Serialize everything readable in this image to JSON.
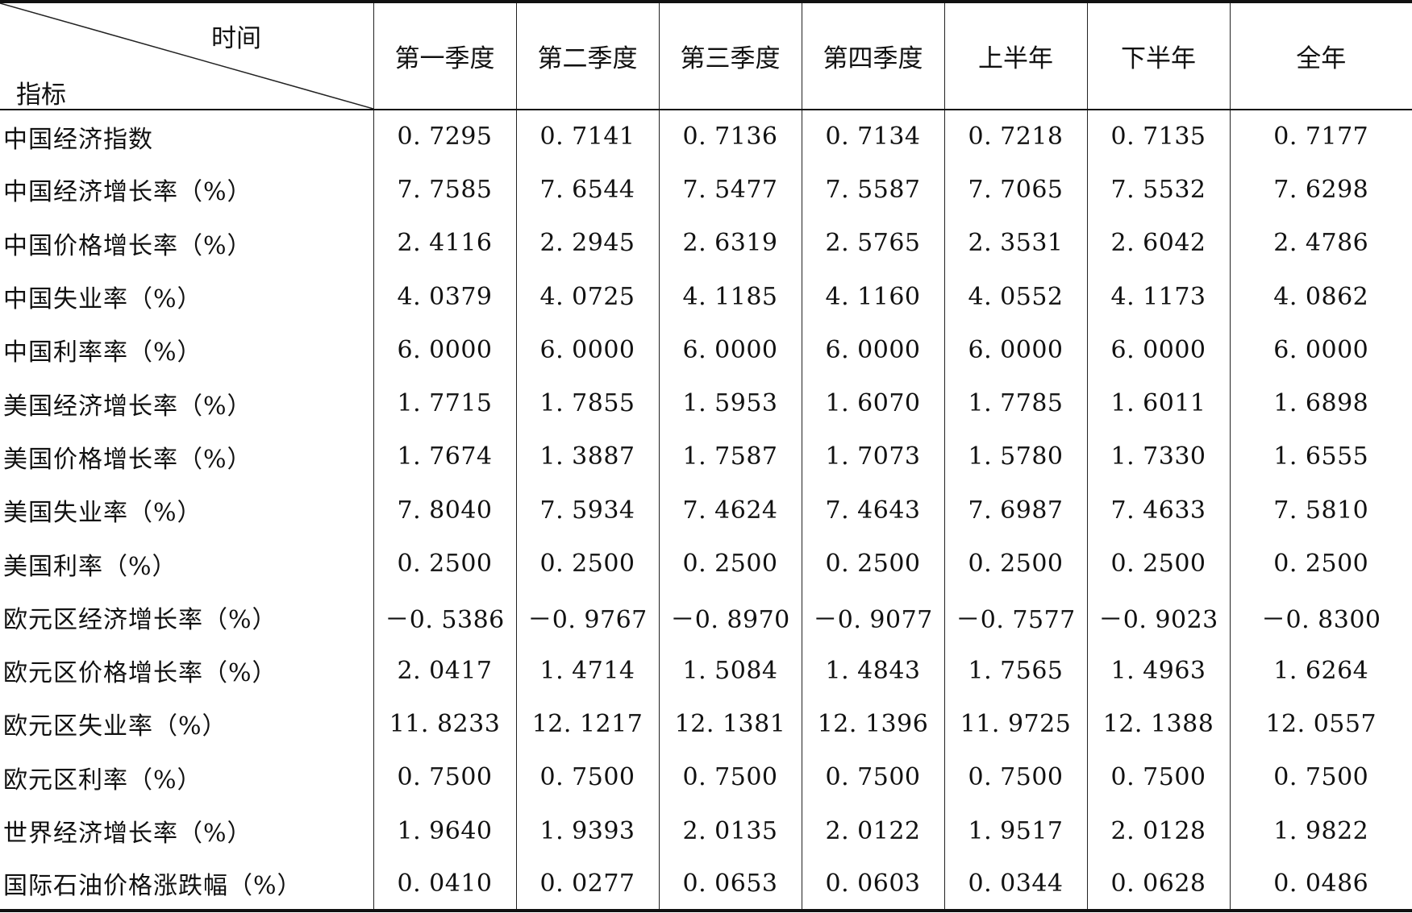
{
  "table": {
    "corner": {
      "top_label": "时间",
      "bottom_label": "指标"
    },
    "columns": [
      "第一季度",
      "第二季度",
      "第三季度",
      "第四季度",
      "上半年",
      "下半年",
      "全年"
    ],
    "rows": [
      {
        "indicator": "中国经济指数",
        "values": [
          "0. 7295",
          "0. 7141",
          "0. 7136",
          "0. 7134",
          "0. 7218",
          "0. 7135",
          "0. 7177"
        ]
      },
      {
        "indicator": "中国经济增长率（%）",
        "values": [
          "7. 7585",
          "7. 6544",
          "7. 5477",
          "7. 5587",
          "7. 7065",
          "7. 5532",
          "7. 6298"
        ]
      },
      {
        "indicator": "中国价格增长率（%）",
        "values": [
          "2. 4116",
          "2. 2945",
          "2. 6319",
          "2. 5765",
          "2. 3531",
          "2. 6042",
          "2. 4786"
        ]
      },
      {
        "indicator": "中国失业率（%）",
        "values": [
          "4. 0379",
          "4. 0725",
          "4. 1185",
          "4. 1160",
          "4. 0552",
          "4. 1173",
          "4. 0862"
        ]
      },
      {
        "indicator": "中国利率率（%）",
        "values": [
          "6. 0000",
          "6. 0000",
          "6. 0000",
          "6. 0000",
          "6. 0000",
          "6. 0000",
          "6. 0000"
        ]
      },
      {
        "indicator": "美国经济增长率（%）",
        "values": [
          "1. 7715",
          "1. 7855",
          "1. 5953",
          "1. 6070",
          "1. 7785",
          "1. 6011",
          "1. 6898"
        ]
      },
      {
        "indicator": "美国价格增长率（%）",
        "values": [
          "1. 7674",
          "1. 3887",
          "1. 7587",
          "1. 7073",
          "1. 5780",
          "1. 7330",
          "1. 6555"
        ]
      },
      {
        "indicator": "美国失业率（%）",
        "values": [
          "7. 8040",
          "7. 5934",
          "7. 4624",
          "7. 4643",
          "7. 6987",
          "7. 4633",
          "7. 5810"
        ]
      },
      {
        "indicator": "美国利率（%）",
        "values": [
          "0. 2500",
          "0. 2500",
          "0. 2500",
          "0. 2500",
          "0. 2500",
          "0. 2500",
          "0. 2500"
        ]
      },
      {
        "indicator": "欧元区经济增长率（%）",
        "values": [
          "－0. 5386",
          "－0. 9767",
          "－0. 8970",
          "－0. 9077",
          "－0. 7577",
          "－0. 9023",
          "－0. 8300"
        ]
      },
      {
        "indicator": "欧元区价格增长率（%）",
        "values": [
          "2. 0417",
          "1. 4714",
          "1. 5084",
          "1. 4843",
          "1. 7565",
          "1. 4963",
          "1. 6264"
        ]
      },
      {
        "indicator": "欧元区失业率（%）",
        "values": [
          "11. 8233",
          "12. 1217",
          "12. 1381",
          "12. 1396",
          "11. 9725",
          "12. 1388",
          "12. 0557"
        ]
      },
      {
        "indicator": "欧元区利率（%）",
        "values": [
          "0. 7500",
          "0. 7500",
          "0. 7500",
          "0. 7500",
          "0. 7500",
          "0. 7500",
          "0. 7500"
        ]
      },
      {
        "indicator": "世界经济增长率（%）",
        "values": [
          "1. 9640",
          "1. 9393",
          "2. 0135",
          "2. 0122",
          "1. 9517",
          "2. 0128",
          "1. 9822"
        ]
      },
      {
        "indicator": "国际石油价格涨跌幅（%）",
        "values": [
          "0. 0410",
          "0. 0277",
          "0. 0653",
          "0. 0603",
          "0. 0344",
          "0. 0628",
          "0. 0486"
        ]
      }
    ]
  }
}
